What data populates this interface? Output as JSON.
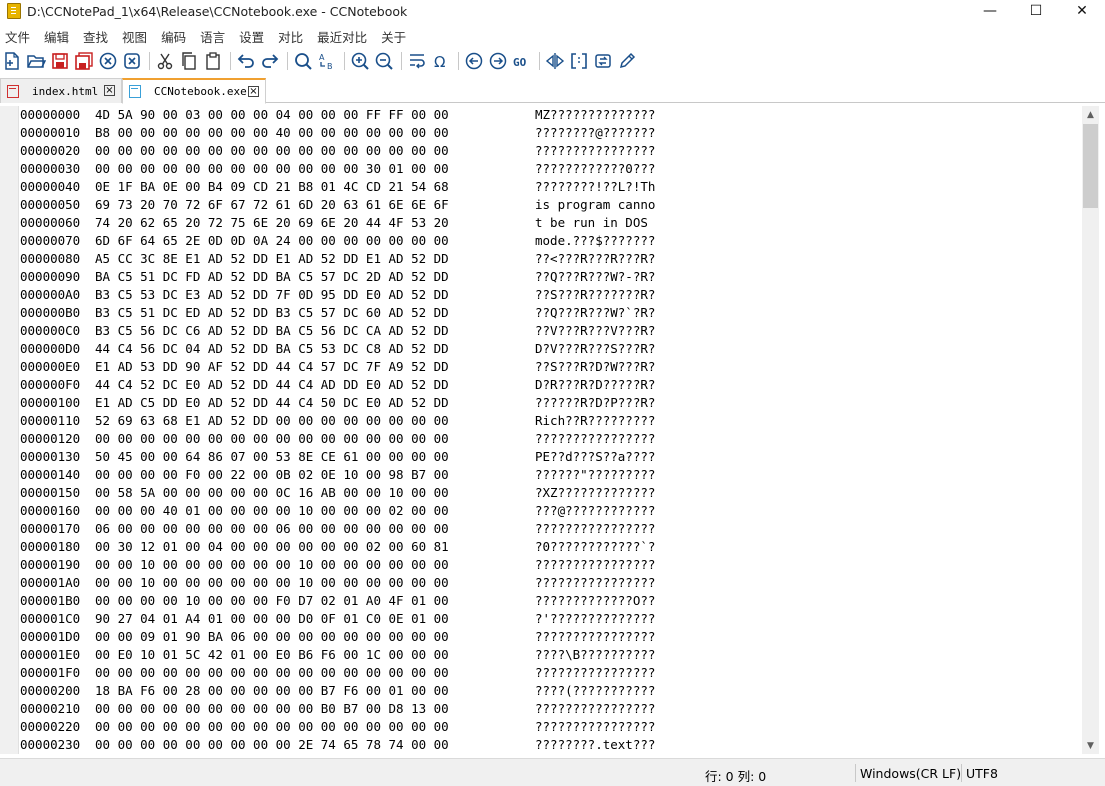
{
  "window": {
    "title": "D:\\CCNotePad_1\\x64\\Release\\CCNotebook.exe - CCNotebook",
    "minimize": "—",
    "maximize": "☐",
    "close": "✕"
  },
  "menu": [
    "文件",
    "编辑",
    "查找",
    "视图",
    "编码",
    "语言",
    "设置",
    "对比",
    "最近对比",
    "关于"
  ],
  "tabs": [
    {
      "label": "index.html",
      "active": false,
      "icon": "file-red-icon"
    },
    {
      "label": "CCNotebook.exe",
      "active": true,
      "icon": "file-blue-icon"
    }
  ],
  "hex_lines": [
    {
      "addr": "00000000",
      "hex": "4D 5A 90 00 03 00 00 00 04 00 00 00 FF FF 00 00",
      "ascii": "MZ??????????????"
    },
    {
      "addr": "00000010",
      "hex": "B8 00 00 00 00 00 00 00 40 00 00 00 00 00 00 00",
      "ascii": "????????@???????"
    },
    {
      "addr": "00000020",
      "hex": "00 00 00 00 00 00 00 00 00 00 00 00 00 00 00 00",
      "ascii": "????????????????"
    },
    {
      "addr": "00000030",
      "hex": "00 00 00 00 00 00 00 00 00 00 00 00 30 01 00 00",
      "ascii": "????????????0???"
    },
    {
      "addr": "00000040",
      "hex": "0E 1F BA 0E 00 B4 09 CD 21 B8 01 4C CD 21 54 68",
      "ascii": "????????!??L?!Th"
    },
    {
      "addr": "00000050",
      "hex": "69 73 20 70 72 6F 67 72 61 6D 20 63 61 6E 6E 6F",
      "ascii": "is program canno"
    },
    {
      "addr": "00000060",
      "hex": "74 20 62 65 20 72 75 6E 20 69 6E 20 44 4F 53 20",
      "ascii": "t be run in DOS "
    },
    {
      "addr": "00000070",
      "hex": "6D 6F 64 65 2E 0D 0D 0A 24 00 00 00 00 00 00 00",
      "ascii": "mode.???$???????"
    },
    {
      "addr": "00000080",
      "hex": "A5 CC 3C 8E E1 AD 52 DD E1 AD 52 DD E1 AD 52 DD",
      "ascii": "??<???R???R???R?"
    },
    {
      "addr": "00000090",
      "hex": "BA C5 51 DC FD AD 52 DD BA C5 57 DC 2D AD 52 DD",
      "ascii": "??Q???R???W?-?R?"
    },
    {
      "addr": "000000A0",
      "hex": "B3 C5 53 DC E3 AD 52 DD 7F 0D 95 DD E0 AD 52 DD",
      "ascii": "??S???R???????R?"
    },
    {
      "addr": "000000B0",
      "hex": "B3 C5 51 DC ED AD 52 DD B3 C5 57 DC 60 AD 52 DD",
      "ascii": "??Q???R???W?`?R?"
    },
    {
      "addr": "000000C0",
      "hex": "B3 C5 56 DC C6 AD 52 DD BA C5 56 DC CA AD 52 DD",
      "ascii": "??V???R???V???R?"
    },
    {
      "addr": "000000D0",
      "hex": "44 C4 56 DC 04 AD 52 DD BA C5 53 DC C8 AD 52 DD",
      "ascii": "D?V???R???S???R?"
    },
    {
      "addr": "000000E0",
      "hex": "E1 AD 53 DD 90 AF 52 DD 44 C4 57 DC 7F A9 52 DD",
      "ascii": "??S???R?D?W???R?"
    },
    {
      "addr": "000000F0",
      "hex": "44 C4 52 DC E0 AD 52 DD 44 C4 AD DD E0 AD 52 DD",
      "ascii": "D?R???R?D?????R?"
    },
    {
      "addr": "00000100",
      "hex": "E1 AD C5 DD E0 AD 52 DD 44 C4 50 DC E0 AD 52 DD",
      "ascii": "??????R?D?P???R?"
    },
    {
      "addr": "00000110",
      "hex": "52 69 63 68 E1 AD 52 DD 00 00 00 00 00 00 00 00",
      "ascii": "Rich??R?????????"
    },
    {
      "addr": "00000120",
      "hex": "00 00 00 00 00 00 00 00 00 00 00 00 00 00 00 00",
      "ascii": "????????????????"
    },
    {
      "addr": "00000130",
      "hex": "50 45 00 00 64 86 07 00 53 8E CE 61 00 00 00 00",
      "ascii": "PE??d???S??a????"
    },
    {
      "addr": "00000140",
      "hex": "00 00 00 00 F0 00 22 00 0B 02 0E 10 00 98 B7 00",
      "ascii": "??????\"?????????"
    },
    {
      "addr": "00000150",
      "hex": "00 58 5A 00 00 00 00 00 0C 16 AB 00 00 10 00 00",
      "ascii": "?XZ?????????????"
    },
    {
      "addr": "00000160",
      "hex": "00 00 00 40 01 00 00 00 00 10 00 00 00 02 00 00",
      "ascii": "???@????????????"
    },
    {
      "addr": "00000170",
      "hex": "06 00 00 00 00 00 00 00 06 00 00 00 00 00 00 00",
      "ascii": "????????????????"
    },
    {
      "addr": "00000180",
      "hex": "00 30 12 01 00 04 00 00 00 00 00 00 02 00 60 81",
      "ascii": "?0????????????`?"
    },
    {
      "addr": "00000190",
      "hex": "00 00 10 00 00 00 00 00 00 10 00 00 00 00 00 00",
      "ascii": "????????????????"
    },
    {
      "addr": "000001A0",
      "hex": "00 00 10 00 00 00 00 00 00 10 00 00 00 00 00 00",
      "ascii": "????????????????"
    },
    {
      "addr": "000001B0",
      "hex": "00 00 00 00 10 00 00 00 F0 D7 02 01 A0 4F 01 00",
      "ascii": "?????????????O??"
    },
    {
      "addr": "000001C0",
      "hex": "90 27 04 01 A4 01 00 00 00 D0 0F 01 C0 0E 01 00",
      "ascii": "?'??????????????"
    },
    {
      "addr": "000001D0",
      "hex": "00 00 09 01 90 BA 06 00 00 00 00 00 00 00 00 00",
      "ascii": "????????????????"
    },
    {
      "addr": "000001E0",
      "hex": "00 E0 10 01 5C 42 01 00 E0 B6 F6 00 1C 00 00 00",
      "ascii": "????\\B??????????"
    },
    {
      "addr": "000001F0",
      "hex": "00 00 00 00 00 00 00 00 00 00 00 00 00 00 00 00",
      "ascii": "????????????????"
    },
    {
      "addr": "00000200",
      "hex": "18 BA F6 00 28 00 00 00 00 00 B7 F6 00 01 00 00",
      "ascii": "????(???????????"
    },
    {
      "addr": "00000210",
      "hex": "00 00 00 00 00 00 00 00 00 00 B0 B7 00 D8 13 00",
      "ascii": "????????????????"
    },
    {
      "addr": "00000220",
      "hex": "00 00 00 00 00 00 00 00 00 00 00 00 00 00 00 00",
      "ascii": "????????????????"
    },
    {
      "addr": "00000230",
      "hex": "00 00 00 00 00 00 00 00 00 2E 74 65 78 74 00 00",
      "ascii": "????????.text???"
    }
  ],
  "status": {
    "position": "行: 0 列: 0",
    "eol": "Windows(CR LF)",
    "encoding": "UTF8"
  }
}
